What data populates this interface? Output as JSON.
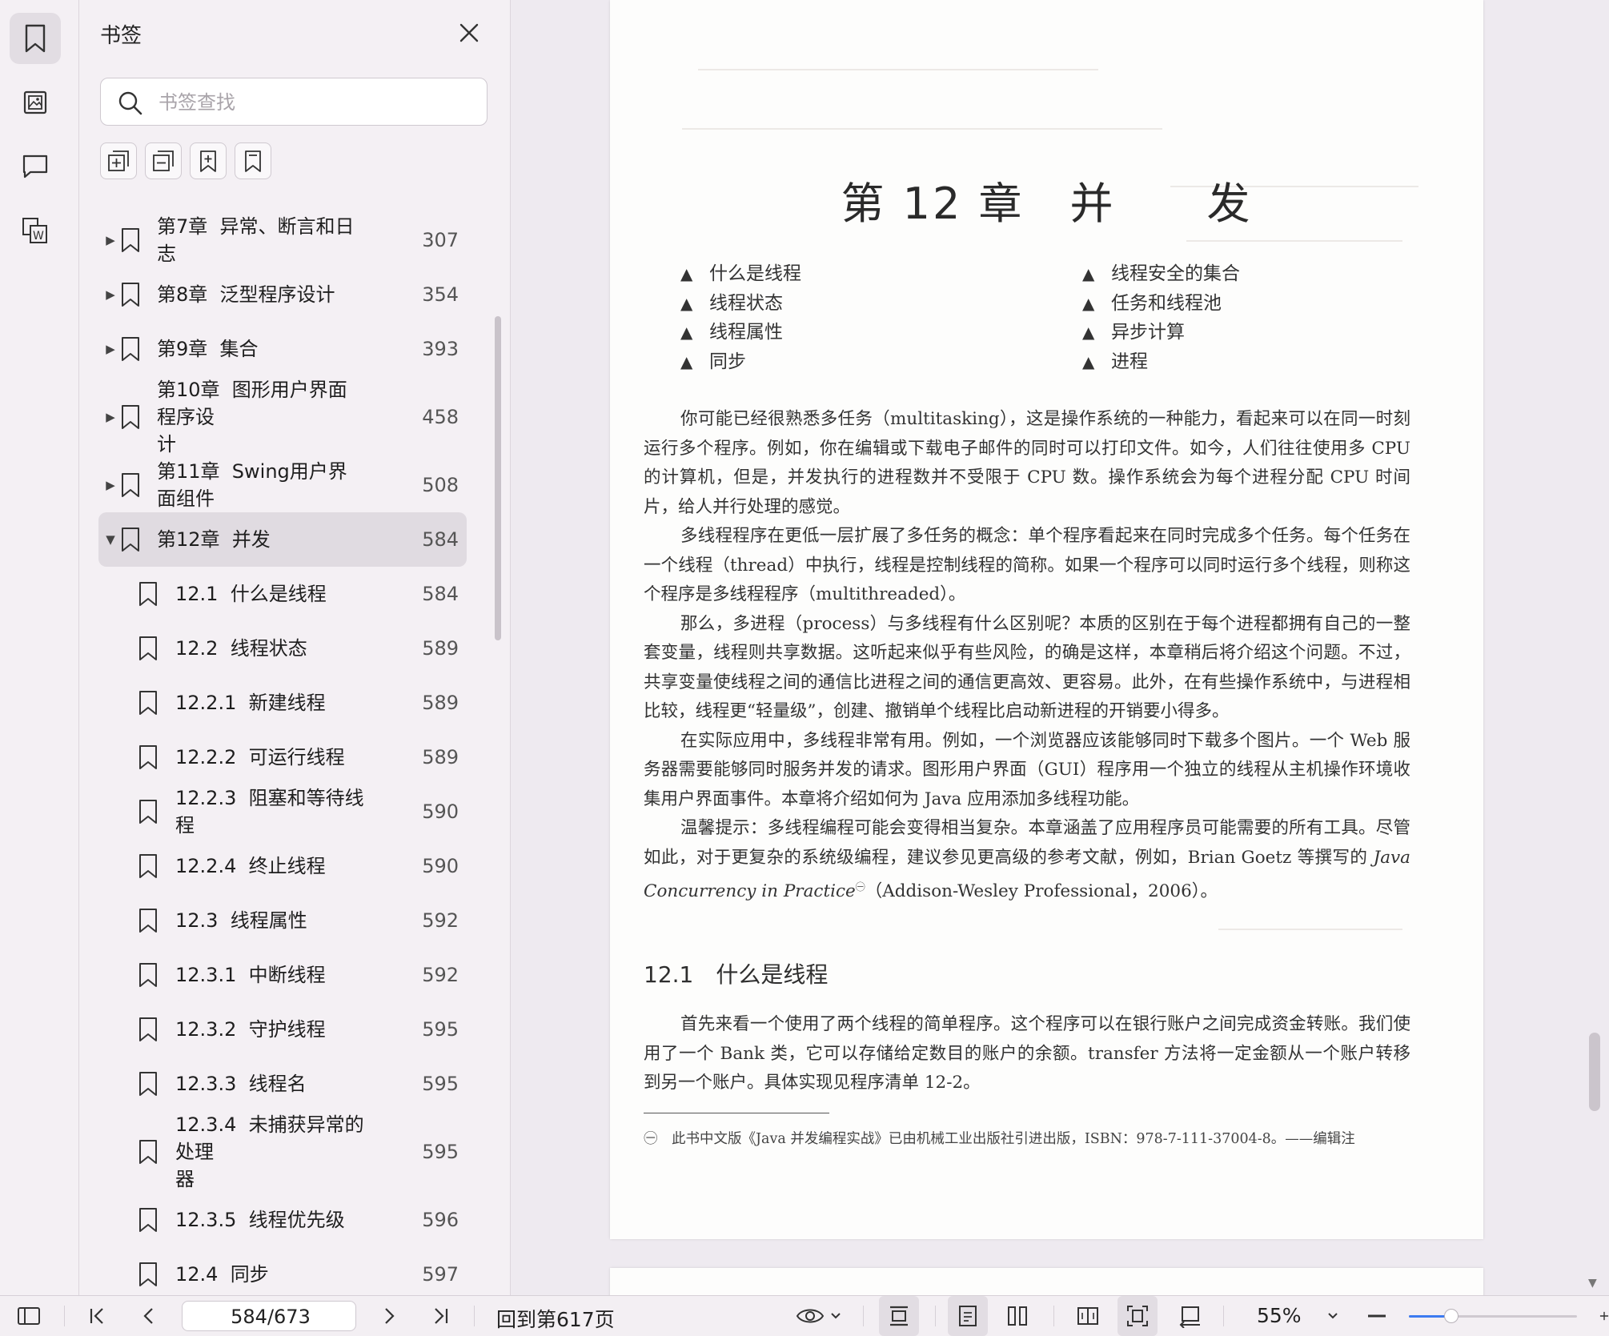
{
  "sidebar_rail": {
    "items": [
      {
        "icon": "bookmark-icon",
        "active": true
      },
      {
        "icon": "thumbnail-icon",
        "active": false
      },
      {
        "icon": "comment-icon",
        "active": false
      },
      {
        "icon": "extract-icon",
        "active": false
      }
    ]
  },
  "bookmarks_panel": {
    "title": "书签",
    "search_placeholder": "书签查找",
    "tools": [
      "add-bookmark-icon",
      "remove-bookmark-icon",
      "add-child-bookmark-icon",
      "bookmark-icon"
    ],
    "items": [
      {
        "label": "第7章  异常、断言和日志",
        "page": "307",
        "level": 0,
        "expandable": true,
        "expanded": false
      },
      {
        "label": "第8章  泛型程序设计",
        "page": "354",
        "level": 0,
        "expandable": true,
        "expanded": false
      },
      {
        "label": "第9章  集合",
        "page": "393",
        "level": 0,
        "expandable": true,
        "expanded": false
      },
      {
        "label": "第10章  图形用户界面程序设\n计",
        "page": "458",
        "level": 0,
        "expandable": true,
        "expanded": false,
        "tall": true
      },
      {
        "label": "第11章  Swing用户界面组件",
        "page": "508",
        "level": 0,
        "expandable": true,
        "expanded": false
      },
      {
        "label": "第12章  并发",
        "page": "584",
        "level": 0,
        "expandable": true,
        "expanded": true,
        "selected": true
      },
      {
        "label": "12.1  什么是线程",
        "page": "584",
        "level": 1
      },
      {
        "label": "12.2  线程状态",
        "page": "589",
        "level": 1
      },
      {
        "label": "12.2.1  新建线程",
        "page": "589",
        "level": 1
      },
      {
        "label": "12.2.2  可运行线程",
        "page": "589",
        "level": 1
      },
      {
        "label": "12.2.3  阻塞和等待线程",
        "page": "590",
        "level": 1
      },
      {
        "label": "12.2.4  终止线程",
        "page": "590",
        "level": 1
      },
      {
        "label": "12.3  线程属性",
        "page": "592",
        "level": 1
      },
      {
        "label": "12.3.1  中断线程",
        "page": "592",
        "level": 1
      },
      {
        "label": "12.3.2  守护线程",
        "page": "595",
        "level": 1
      },
      {
        "label": "12.3.3  线程名",
        "page": "595",
        "level": 1
      },
      {
        "label": "12.3.4  未捕获异常的处理\n器",
        "page": "595",
        "level": 1,
        "tall": true
      },
      {
        "label": "12.3.5  线程优先级",
        "page": "596",
        "level": 1
      },
      {
        "label": "12.4  同步",
        "page": "597",
        "level": 1
      }
    ]
  },
  "document": {
    "chapter_title": "第 12 章　并　　发",
    "toc_left": [
      "什么是线程",
      "线程状态",
      "线程属性",
      "同步"
    ],
    "toc_right": [
      "线程安全的集合",
      "任务和线程池",
      "异步计算",
      "进程"
    ],
    "toc_marker": "▲",
    "paragraphs": [
      "你可能已经很熟悉多任务（multitasking），这是操作系统的一种能力，看起来可以在同一时刻运行多个程序。例如，你在编辑或下载电子邮件的同时可以打印文件。如今，人们往往使用多 CPU 的计算机，但是，并发执行的进程数并不受限于 CPU 数。操作系统会为每个进程分配 CPU 时间片，给人并行处理的感觉。",
      "多线程程序在更低一层扩展了多任务的概念：单个程序看起来在同时完成多个任务。每个任务在一个线程（thread）中执行，线程是控制线程的简称。如果一个程序可以同时运行多个线程，则称这个程序是多线程程序（multithreaded）。",
      "那么，多进程（process）与多线程有什么区别呢？本质的区别在于每个进程都拥有自己的一整套变量，线程则共享数据。这听起来似乎有些风险，的确是这样，本章稍后将介绍这个问题。不过，共享变量使线程之间的通信比进程之间的通信更高效、更容易。此外，在有些操作系统中，与进程相比较，线程更“轻量级”，创建、撤销单个线程比启动新进程的开销要小得多。",
      "在实际应用中，多线程非常有用。例如，一个浏览器应该能够同时下载多个图片。一个 Web 服务器需要能够同时服务并发的请求。图形用户界面（GUI）程序用一个独立的线程从主机操作环境收集用户界面事件。本章将介绍如何为 Java 应用添加多线程功能。"
    ],
    "tip_text_a": "温馨提示：多线程编程可能会变得相当复杂。本章涵盖了应用程序员可能需要的所有工具。尽管如此，对于更复杂的系统级编程，建议参见更高级的参考文献，例如，Brian Goetz 等撰写的 ",
    "tip_italic": "Java Concurrency in Practice",
    "tip_sup": "㊀",
    "tip_text_b": "（Addison-Wesley Professional，2006）。",
    "section_heading": "12.1　什么是线程",
    "section_paragraph": "首先来看一个使用了两个线程的简单程序。这个程序可以在银行账户之间完成资金转账。我们使用了一个 Bank 类，它可以存储给定数目的账户的余额。transfer 方法将一定金额从一个账户转移到另一个账户。具体实现见程序清单 12-2。",
    "footnote": "㊀　此书中文版《Java 并发编程实战》已由机械工业出版社引进出版，ISBN：978-7-111-37004-8。——编辑注"
  },
  "bottom_bar": {
    "current_page": "584/673",
    "goto_label": "回到第617页",
    "zoom": "55%",
    "zoom_slider_fraction": 0.25
  },
  "colors": {
    "accent": "#3d7bf0",
    "sidebar_bg": "#f4f0f4",
    "selected_row": "#e0dbe1"
  }
}
